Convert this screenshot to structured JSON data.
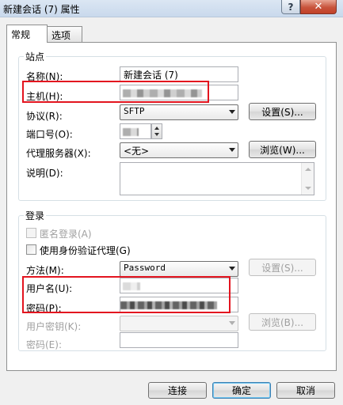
{
  "window": {
    "title": "新建会话 (7) 属性",
    "help_label": "?",
    "close_label": "✕"
  },
  "tabs": [
    {
      "label": "常规",
      "selected": true
    },
    {
      "label": "选项",
      "selected": false
    }
  ],
  "site": {
    "group_label": "站点",
    "name_label": "名称(N):",
    "name_value": "新建会话 (7)",
    "host_label": "主机(H):",
    "protocol_label": "协议(R):",
    "protocol_value": "SFTP",
    "settings_button": "设置(S)...",
    "port_label": "端口号(O):",
    "proxy_label": "代理服务器(X):",
    "proxy_value": "<无>",
    "browse_button": "浏览(W)...",
    "description_label": "说明(D):"
  },
  "login": {
    "group_label": "登录",
    "anonymous_label": "匿名登录(A)",
    "agent_label": "使用身份验证代理(G)",
    "method_label": "方法(M):",
    "method_value": "Password",
    "method_settings_button": "设置(S)...",
    "username_label": "用户名(U):",
    "password_label": "密码(P):",
    "user_key_label": "用户密钥(K):",
    "user_key_browse_button": "浏览(B)...",
    "passphrase_label": "密码(E):"
  },
  "footer": {
    "connect_button": "连接",
    "ok_button": "确定",
    "cancel_button": "取消"
  },
  "colors": {
    "highlight": "#e3141f"
  }
}
